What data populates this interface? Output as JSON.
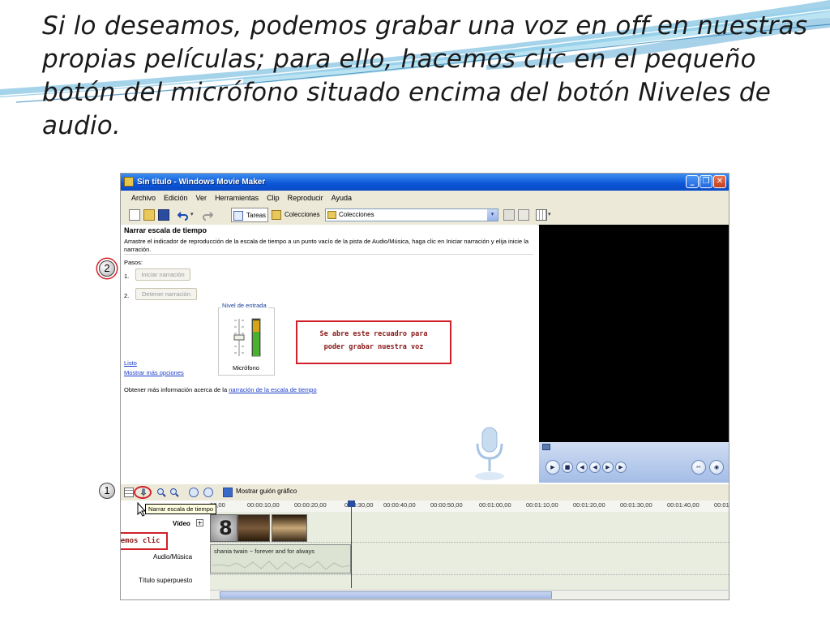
{
  "slide": {
    "text": "Si lo deseamos, podemos grabar una voz en off en nuestras propias películas; para ello, hacemos clic en el pequeño botón del micrófono situado encima del botón Niveles de audio."
  },
  "window": {
    "title": "Sin título - Windows Movie Maker",
    "minimize": "_",
    "maximize": "❐",
    "close": "✕"
  },
  "menu": [
    "Archivo",
    "Edición",
    "Ver",
    "Herramientas",
    "Clip",
    "Reproducir",
    "Ayuda"
  ],
  "toolbar": {
    "tasks_label": "Tareas",
    "collections_label": "Colecciones",
    "collections_combo": "Colecciones",
    "undo_arrow": "▾",
    "combo_arrow": "▾",
    "views_arrow": "▾"
  },
  "narrate_pane": {
    "heading": "Narrar escala de tiempo",
    "description": "Arrastre el indicador de reproducción de la escala de tiempo a un punto vacío de la pista de Audio/Música, haga clic en Iniciar narración y elija inicie la narración.",
    "steps_label": "Pasos:",
    "step1_num": "1.",
    "step1_button": "Iniciar narración",
    "step2_num": "2.",
    "step2_button": "Detener narración",
    "level_title": "Nivel de entrada",
    "mic_label": "Micrófono",
    "link_done": "Listo",
    "link_more": "Mostrar más opciones",
    "info_prefix": "Obtener más información acerca de la",
    "info_link": "narración de la escala de tiempo"
  },
  "callout": {
    "line1": "Se abre este recuadro para",
    "line2": "poder grabar nuestra voz"
  },
  "annotations": {
    "step2_badge": "2",
    "step1_badge": "1",
    "click_here": "Hacemos clic"
  },
  "timeline": {
    "show_storyboard": "Mostrar guión gráfico",
    "tooltip": "Narrar escala de tiempo",
    "ruler_ticks": [
      "00,00",
      "00:00:10,00",
      "00:00:20,00",
      "0:00:30,00",
      "00:00:40,00",
      "00:00:50,00",
      "00:01:00,00",
      "00:01:10,00",
      "00:01:20,00",
      "00:01:30,00",
      "00:01:40,00",
      "00:01"
    ],
    "video_label": "Vídeo",
    "video_expand": "+",
    "audio_label": "Audio/Música",
    "title_label": "Título superpuesto",
    "audio_clip_name": "shania twain ~ forever and for always",
    "intro_clip_number": "8"
  },
  "colors": {
    "titlebar": "#0b55d6",
    "annotation_red": "#d0212a",
    "link_blue": "#1a3cc8",
    "timeline_track": "#e8ede0"
  }
}
